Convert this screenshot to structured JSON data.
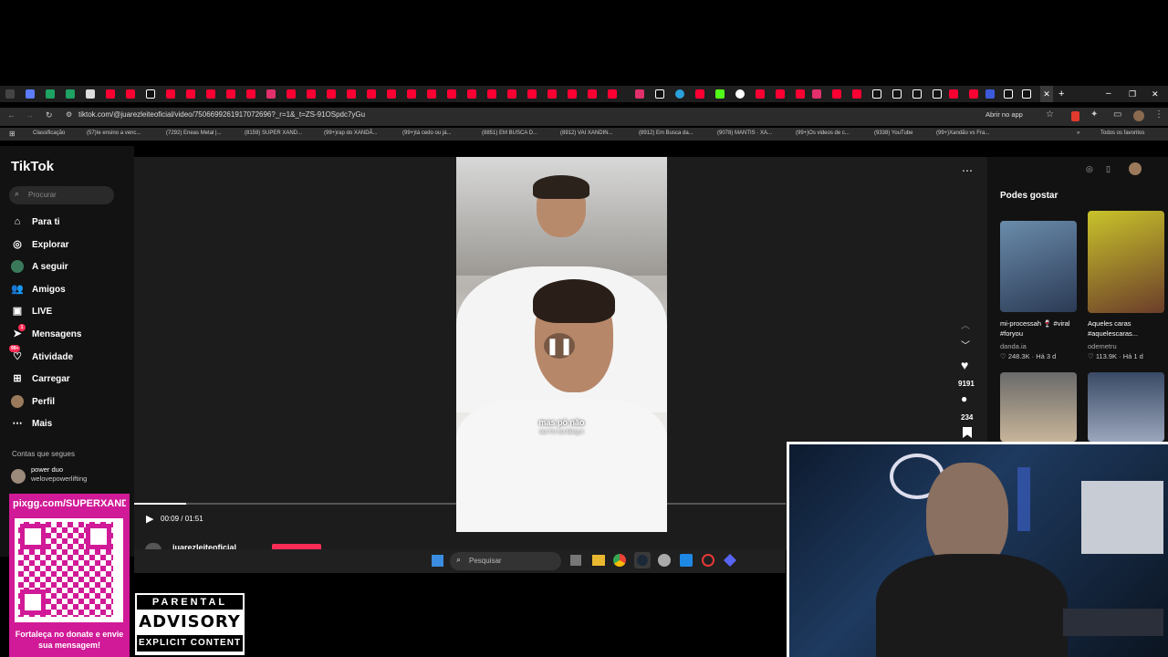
{
  "browser": {
    "url": "tiktok.com/@juarezleiteoficial/video/7506699261917072696?_r=1&_t=ZS-91OSpdc7yGu",
    "open_in_app": "Abrir no app",
    "bookmarks": [
      "Classificação",
      "(57)Ie ensino a venc...",
      "(7292) Eneas Metal |...",
      "(8159) SUPER XAND...",
      "(99+)rap do XANDÃ...",
      "(99+)tá cedo ou já...",
      "(8851) EM BUSCA D...",
      "(8912) VAI XANDIN...",
      "(8912) Em Busca da...",
      "(9078) MANTIS · XA...",
      "(99+)Os videos de c...",
      "(9338) YouTube",
      "(99+)Xandão vs Fra..."
    ],
    "all_favorites": "Todos os favoritos"
  },
  "tiktok": {
    "logo": "TikTok",
    "search_placeholder": "Procurar",
    "nav": [
      "Para ti",
      "Explorar",
      "A seguir",
      "Amigos",
      "LIVE",
      "Mensagens",
      "Atividade",
      "Carregar",
      "Perfil",
      "Mais"
    ],
    "messages_badge": "1",
    "activity_badge": "99+",
    "following_title": "Contas que segues",
    "following": [
      {
        "name": "power duo",
        "handle": "welovepowerlifting"
      }
    ],
    "video": {
      "caption_pt": "mas pô não",
      "caption_en": "but I'm not liking it",
      "time": "00:09 / 01:51",
      "progress": 0.08,
      "likes": "9191",
      "comments": "234",
      "author": "juarezleiteoficial"
    },
    "suggestions_title": "Podes gostar",
    "suggestions": [
      {
        "title": "mi-processah 🍷 #viral #foryou",
        "author": "danda.ia",
        "stats": "248.3K · Há 3 d"
      },
      {
        "title": "Aqueles caras #aquelescaras...",
        "author": "odemetru",
        "stats": "113.9K · Há 1 d"
      }
    ]
  },
  "taskbar": {
    "search_placeholder": "Pesquisar"
  },
  "overlay": {
    "pix_url": "pixgg.com/SUPERXANDÃ",
    "donate_text": "Fortaleça no donate e envie sua mensagem!",
    "advisory": {
      "line1": "PARENTAL",
      "line2": "ADVISORY",
      "line3": "EXPLICIT CONTENT"
    }
  },
  "colors": {
    "tiktok_red": "#fe2c55",
    "pix_pink": "#d11a97",
    "webcam_blue": "#1e3a5f"
  }
}
